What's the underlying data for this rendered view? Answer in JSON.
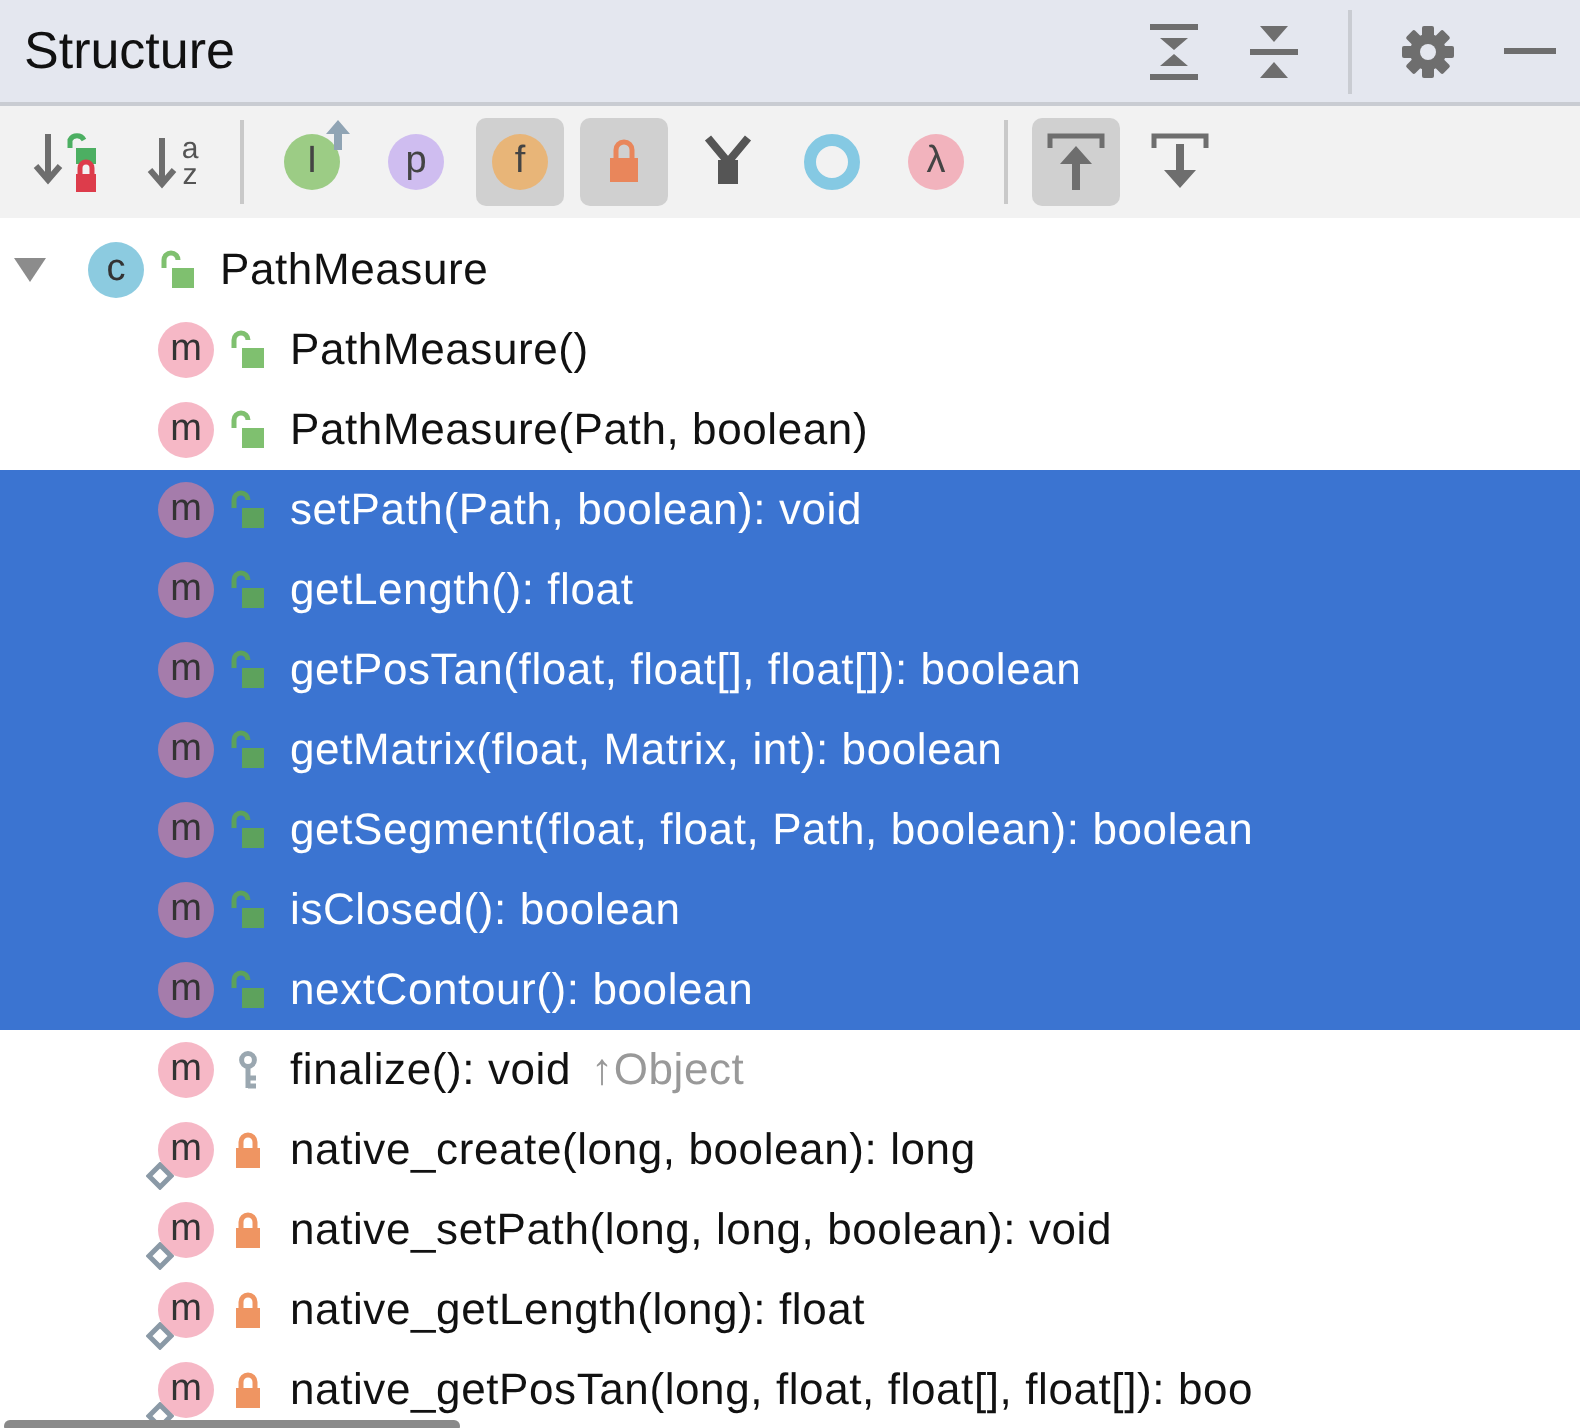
{
  "header": {
    "title": "Structure"
  },
  "toolbar": [
    {
      "kind": "sort-visibility",
      "on": false
    },
    {
      "kind": "sort-alpha",
      "glyph": "a",
      "glyph2": "z",
      "on": false
    },
    {
      "kind": "separator"
    },
    {
      "kind": "circle",
      "glyph": "I",
      "color": "#9ccc85",
      "arrow": true,
      "on": false
    },
    {
      "kind": "circle",
      "glyph": "p",
      "color": "#cfbdf0",
      "arrow": false,
      "on": false
    },
    {
      "kind": "circle",
      "glyph": "f",
      "color": "#e8b578",
      "arrow": false,
      "on": true
    },
    {
      "kind": "lock",
      "on": true
    },
    {
      "kind": "merge",
      "on": false
    },
    {
      "kind": "ring",
      "color": "#85c9e3",
      "on": false
    },
    {
      "kind": "circle",
      "glyph": "λ",
      "color": "#f2b3bd",
      "arrow": false,
      "on": false
    },
    {
      "kind": "separator"
    },
    {
      "kind": "scroll-to",
      "on": true
    },
    {
      "kind": "scroll-from",
      "on": false
    }
  ],
  "tree": {
    "root": {
      "icon": "c",
      "text": "PathMeasure",
      "expanded": true,
      "kind": "public"
    },
    "children": [
      {
        "icon": "m",
        "kind": "public",
        "native": false,
        "selected": false,
        "text": "PathMeasure()"
      },
      {
        "icon": "m",
        "kind": "public",
        "native": false,
        "selected": false,
        "text": "PathMeasure(Path, boolean)"
      },
      {
        "icon": "m",
        "kind": "public",
        "native": false,
        "selected": true,
        "text": "setPath(Path, boolean): void"
      },
      {
        "icon": "m",
        "kind": "public",
        "native": false,
        "selected": true,
        "text": "getLength(): float"
      },
      {
        "icon": "m",
        "kind": "public",
        "native": false,
        "selected": true,
        "text": "getPosTan(float, float[], float[]): boolean"
      },
      {
        "icon": "m",
        "kind": "public",
        "native": false,
        "selected": true,
        "text": "getMatrix(float, Matrix, int): boolean"
      },
      {
        "icon": "m",
        "kind": "public",
        "native": false,
        "selected": true,
        "text": "getSegment(float, float, Path, boolean): boolean"
      },
      {
        "icon": "m",
        "kind": "public",
        "native": false,
        "selected": true,
        "text": "isClosed(): boolean"
      },
      {
        "icon": "m",
        "kind": "public",
        "native": false,
        "selected": true,
        "text": "nextContour(): boolean"
      },
      {
        "icon": "m",
        "kind": "protected",
        "native": false,
        "selected": false,
        "text": "finalize(): void",
        "inherited": "↑Object"
      },
      {
        "icon": "m",
        "kind": "private",
        "native": true,
        "selected": false,
        "text": "native_create(long, boolean): long"
      },
      {
        "icon": "m",
        "kind": "private",
        "native": true,
        "selected": false,
        "text": "native_setPath(long, long, boolean): void"
      },
      {
        "icon": "m",
        "kind": "private",
        "native": true,
        "selected": false,
        "text": "native_getLength(long): float"
      },
      {
        "icon": "m",
        "kind": "private",
        "native": true,
        "selected": false,
        "text": "native_getPosTan(long, float, float[], float[]): boo"
      }
    ]
  }
}
